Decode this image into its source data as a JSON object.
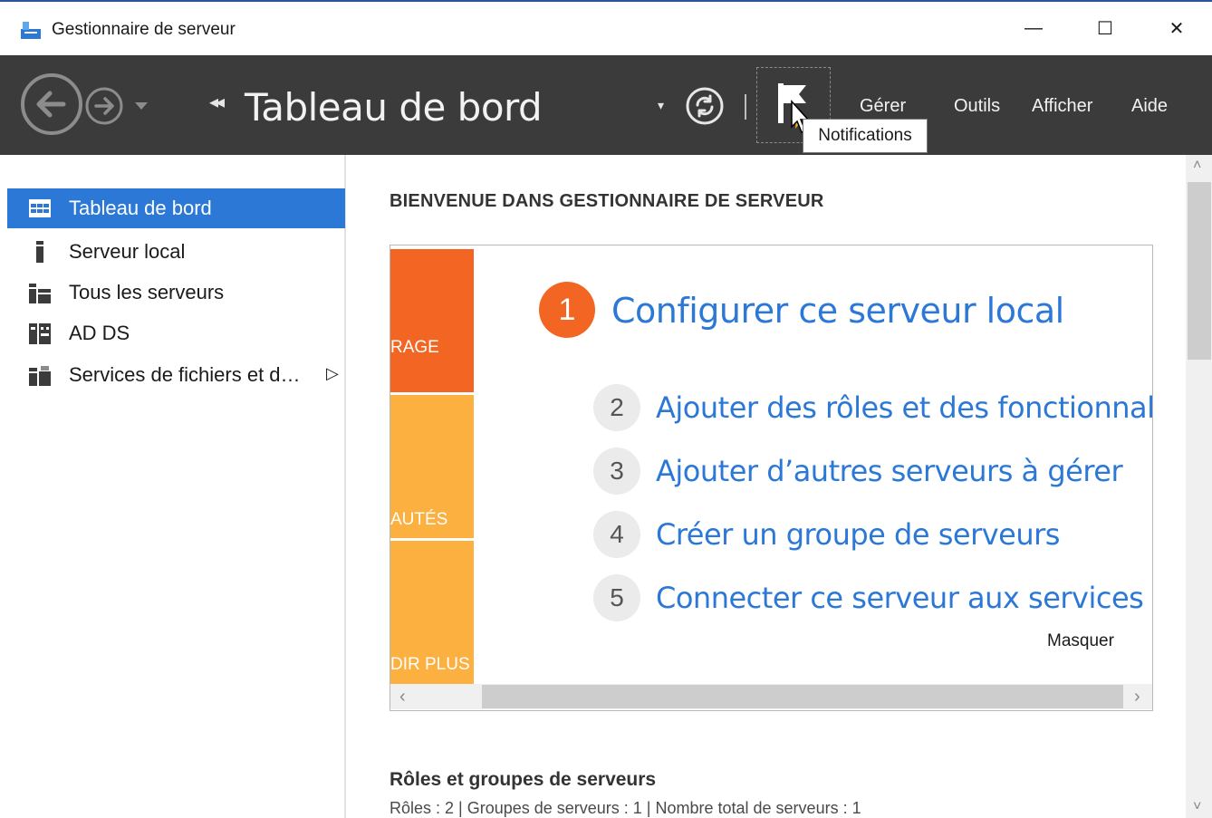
{
  "window": {
    "title": "Gestionnaire de serveur",
    "minimize_glyph": "—",
    "maximize_glyph": "☐",
    "close_glyph": "✕"
  },
  "toolbar": {
    "breadcrumb_arrows": "◂◂",
    "title": "Tableau de bord",
    "dropdown_glyph": "▾",
    "menus": [
      "Gérer",
      "Outils",
      "Afficher",
      "Aide"
    ],
    "tooltip": "Notifications"
  },
  "sidebar": {
    "items": [
      {
        "label": "Tableau de bord",
        "icon": "dashboard-grid-icon",
        "active": true
      },
      {
        "label": "Serveur local",
        "icon": "server-icon",
        "active": false
      },
      {
        "label": "Tous les serveurs",
        "icon": "servers-icon",
        "active": false
      },
      {
        "label": "AD DS",
        "icon": "ad-ds-icon",
        "active": false
      },
      {
        "label": "Services de fichiers et d…",
        "icon": "file-services-icon",
        "active": false,
        "expandable": true
      }
    ],
    "expand_glyph": "▷"
  },
  "main": {
    "welcome_title": "BIENVENUE DANS GESTIONNAIRE DE SERVEUR",
    "tiles": [
      {
        "label": "RAGE",
        "color": "#f26522"
      },
      {
        "label": "AUTÉS",
        "color": "#fbb040"
      },
      {
        "label": "DIR PLUS",
        "color": "#fbb040"
      }
    ],
    "steps": [
      {
        "number": "1",
        "label": "Configurer ce serveur local"
      },
      {
        "number": "2",
        "label": "Ajouter des rôles et des fonctionnalités"
      },
      {
        "number": "3",
        "label": "Ajouter d’autres serveurs à gérer"
      },
      {
        "number": "4",
        "label": "Créer un groupe de serveurs"
      },
      {
        "number": "5",
        "label": "Connecter ce serveur aux services cloud"
      }
    ],
    "hide_link": "Masquer",
    "scroll_left": "‹",
    "scroll_right": "›",
    "roles_title": "Rôles et groupes de serveurs",
    "roles_summary": "Rôles : 2   |   Groupes de serveurs : 1   |   Nombre total de serveurs : 1"
  },
  "scrollbar": {
    "up": "˄",
    "down": "˅"
  },
  "colors": {
    "accent": "#2b78d6",
    "toolbar_bg": "#3b3b3b",
    "step1": "#f26522",
    "step_inactive": "#ebebeb"
  }
}
